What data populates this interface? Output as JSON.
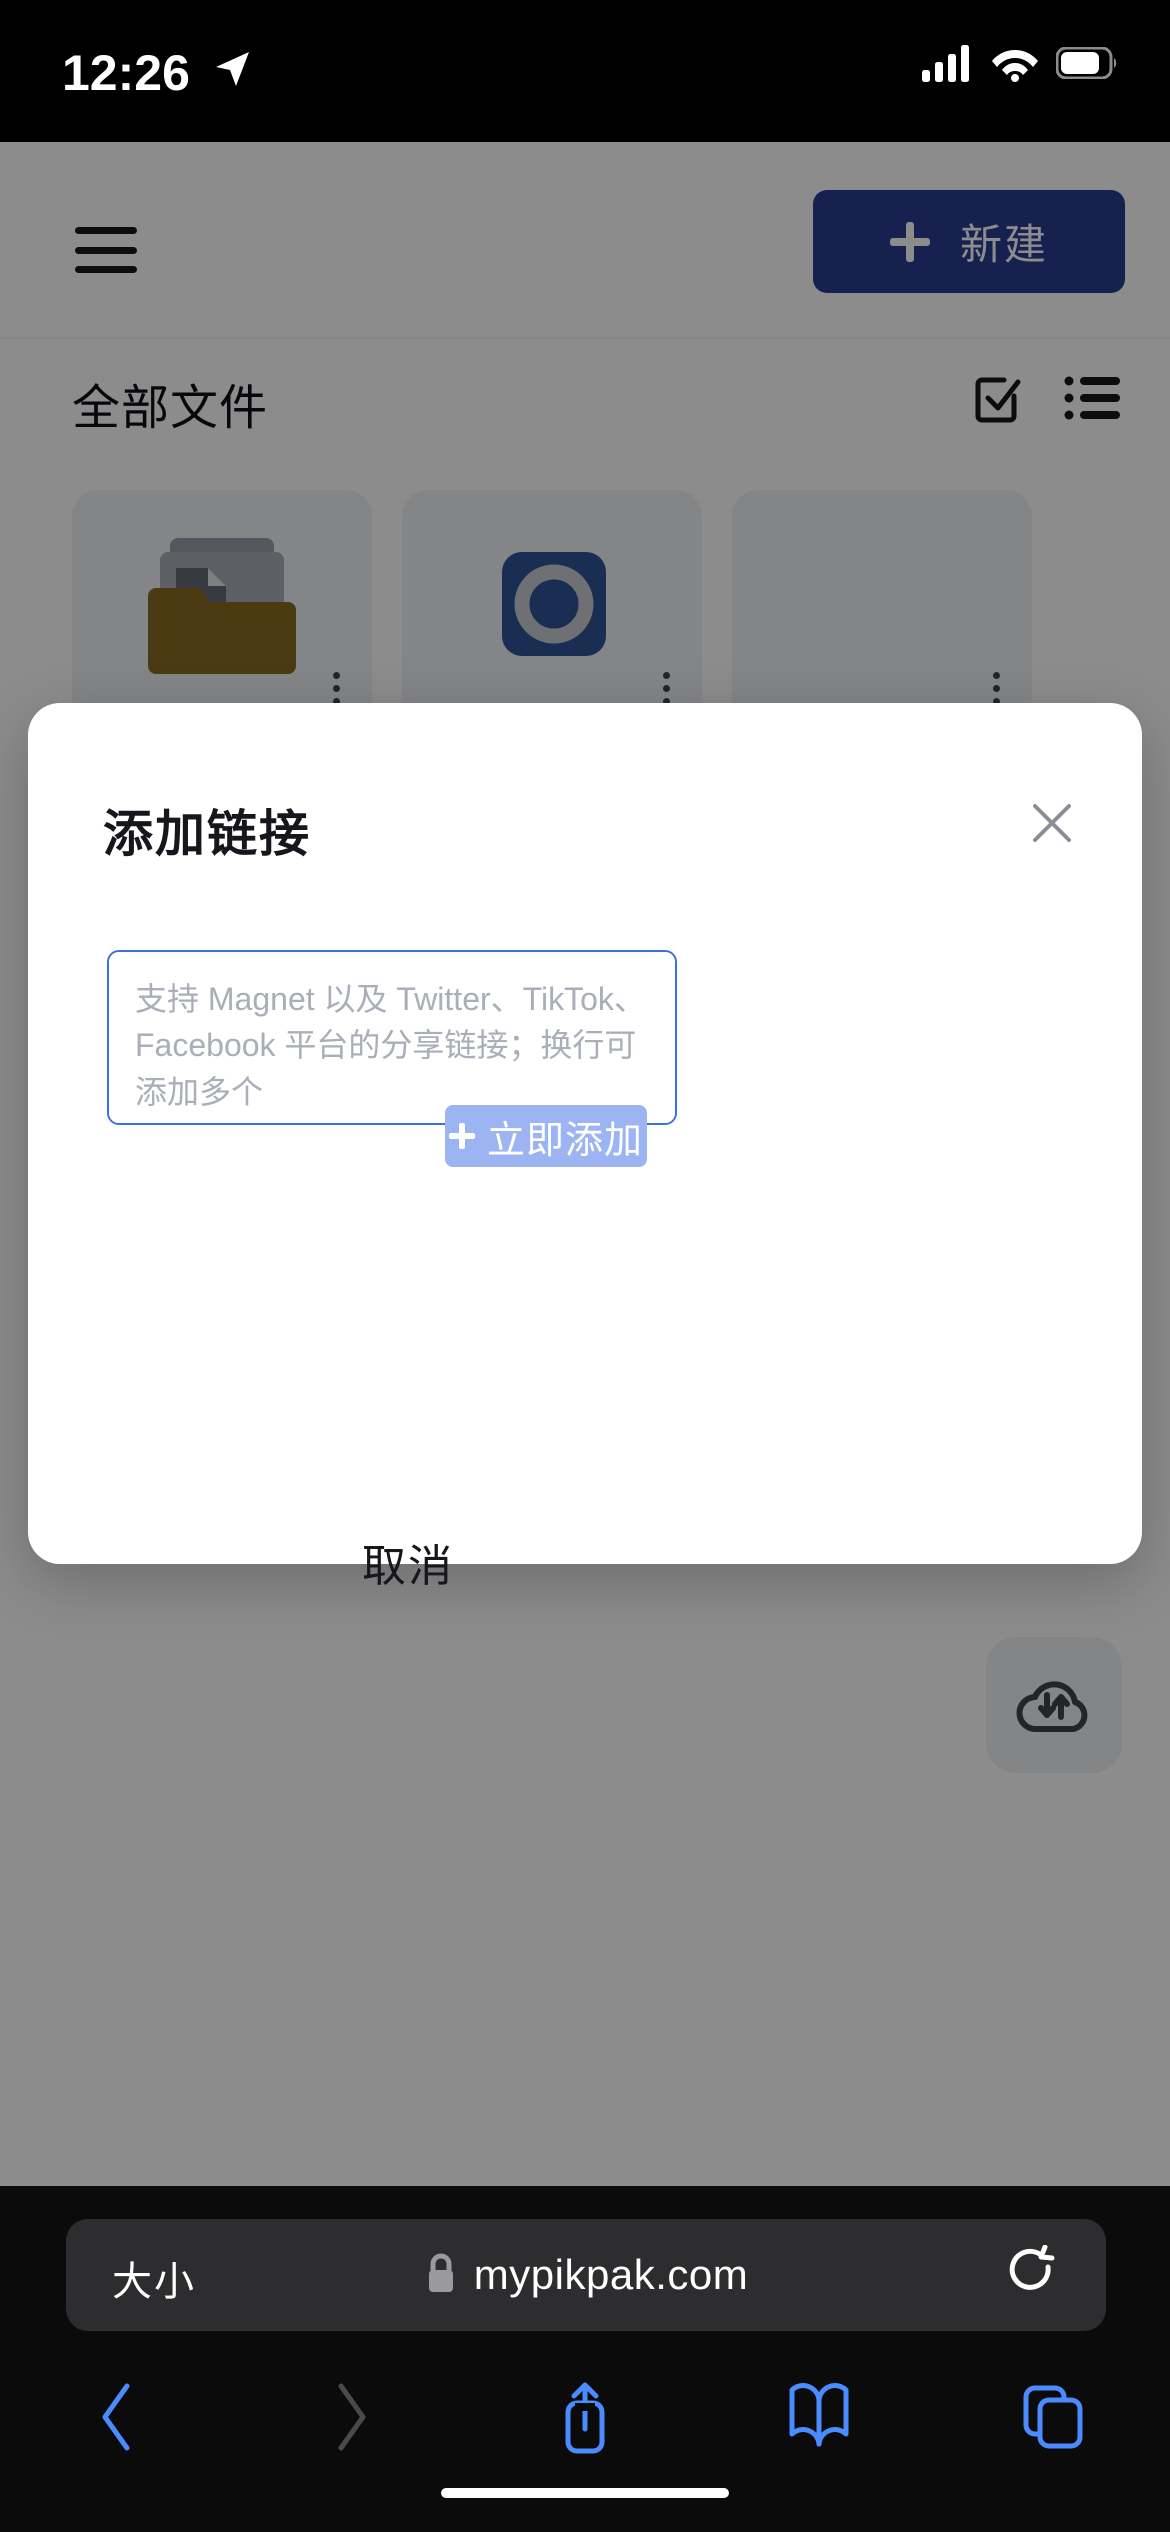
{
  "status_bar": {
    "time": "12:26",
    "location_icon": "location-arrow-icon",
    "signal_icon": "cellular-signal-icon",
    "wifi_icon": "wifi-icon",
    "battery_icon": "battery-icon"
  },
  "app": {
    "menu_icon": "hamburger-menu-icon",
    "new_button_label": "新建",
    "new_button_icon": "plus-icon",
    "new_button_color": "#2b3c91",
    "file_bar": {
      "title": "全部文件",
      "select_icon": "checkbox-select-icon",
      "list_view_icon": "list-view-icon"
    },
    "cards": [
      {
        "name": "folder-card",
        "icon": "folder-with-document-icon",
        "color": "#8a6a22"
      },
      {
        "name": "media-card",
        "icon": "disc-record-icon",
        "color": "#2f5596"
      },
      {
        "name": "third-card",
        "icon": "file-icon",
        "color": "#c8ccd4"
      }
    ],
    "fab": {
      "icon": "cloud-transfer-icon",
      "label": ""
    }
  },
  "dialog": {
    "title": "添加链接",
    "close_icon": "close-x-icon",
    "input": {
      "value": "",
      "placeholder": "支持 Magnet 以及 Twitter、TikTok、Facebook 平台的分享链接；换行可添加多个",
      "border_color": "#3c6ede"
    },
    "cancel_label": "取消",
    "submit_label": "立即添加",
    "submit_icon": "plus-icon",
    "submit_color": "#9db4f2"
  },
  "safari": {
    "text_size_label": "大小",
    "lock_icon": "lock-icon",
    "domain": "mypikpak.com",
    "reload_icon": "reload-icon",
    "toolbar": {
      "back_icon": "chevron-left-icon",
      "forward_icon": "chevron-right-icon",
      "share_icon": "share-icon",
      "bookmarks_icon": "book-icon",
      "tabs_icon": "tabs-icon",
      "accent_color": "#4a8cff",
      "disabled_color": "#4a4a4a"
    }
  }
}
